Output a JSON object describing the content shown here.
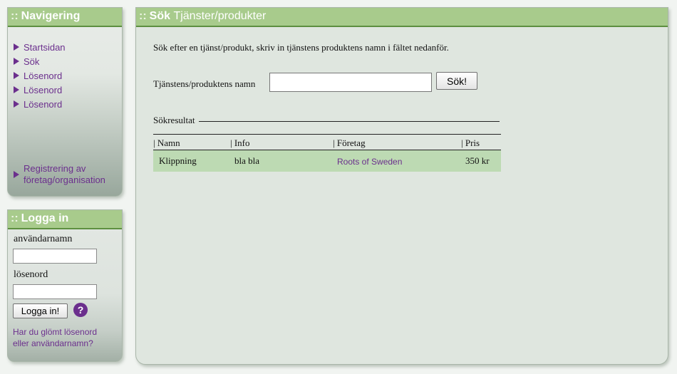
{
  "navigation": {
    "title_prefix": "::",
    "title": "Navigering",
    "items": [
      {
        "label": "Startsidan"
      },
      {
        "label": "Sök"
      },
      {
        "label": "Lösenord"
      },
      {
        "label": "Lösenord"
      },
      {
        "label": "Lösenord"
      }
    ],
    "register_line1": "Registrering av",
    "register_line2": "företag/organisation"
  },
  "login": {
    "title_prefix": "::",
    "title": "Logga in",
    "username_label": "användarnamn",
    "username_value": "",
    "password_label": "lösenord",
    "password_value": "",
    "button_label": "Logga in!",
    "help_label": "?",
    "forgot_line1": "Har du glömt lösenord",
    "forgot_line2": "eller användarnamn?"
  },
  "main": {
    "title_prefix": "::",
    "title_strong": "Sök",
    "title_rest": "Tjänster/produkter",
    "intro": "Sök efter en tjänst/produkt, skriv in tjänstens produktens namn i fältet nedanför.",
    "field_label": "Tjänstens/produktens namn",
    "search_value": "",
    "search_button": "Sök!",
    "results_title": "Sökresultat",
    "columns": [
      "| Namn",
      "| Info",
      "| Företag",
      "| Pris"
    ],
    "rows": [
      {
        "name": "Klippning",
        "info": "bla bla",
        "company": "Roots of Sweden",
        "price": "350 kr"
      }
    ]
  },
  "colors": {
    "header_green": "#a8cb8c",
    "link_purple": "#6b2f8d",
    "row_green": "#bddab3"
  },
  "icons": {
    "nav_bullet": "triangle-right-icon",
    "help": "question-mark-icon"
  }
}
